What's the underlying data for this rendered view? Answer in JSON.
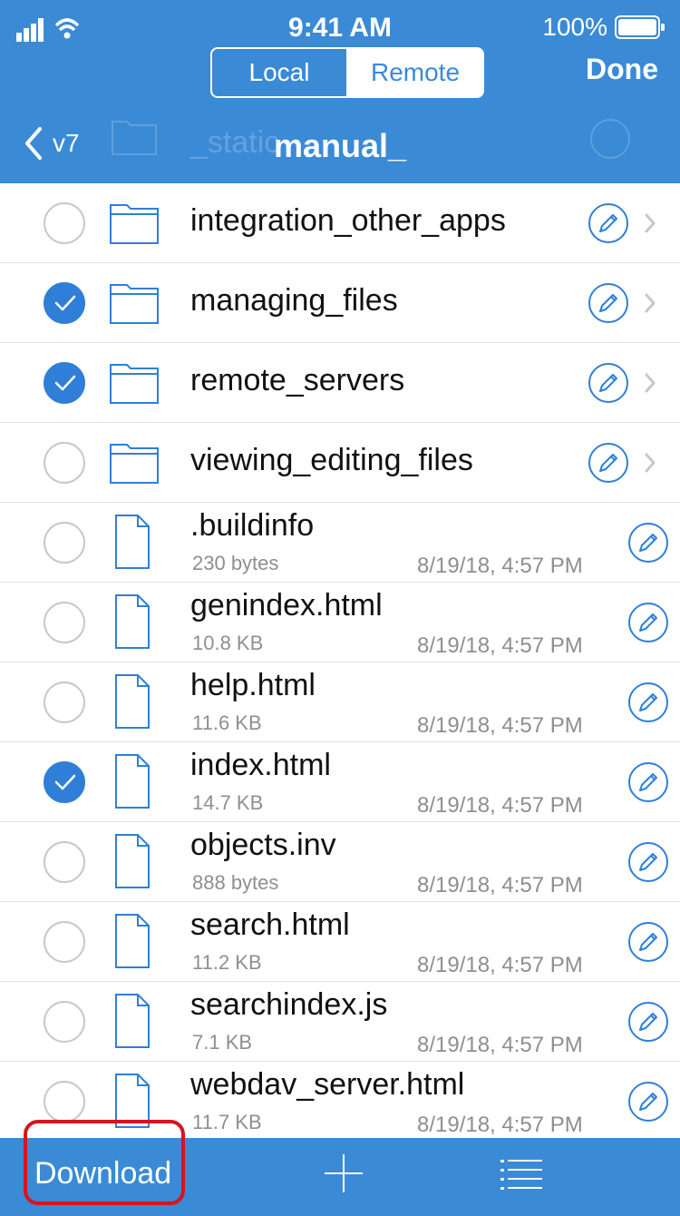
{
  "status_bar": {
    "time": "9:41 AM",
    "battery": "100%"
  },
  "nav": {
    "segments": {
      "local": "Local",
      "remote": "Remote",
      "selected": "Remote"
    },
    "done_label": "Done",
    "back_label": "v7",
    "title": "manual_",
    "ghost_label": "_static"
  },
  "items": [
    {
      "name": "integration_other_apps",
      "type": "folder",
      "checked": false
    },
    {
      "name": "managing_files",
      "type": "folder",
      "checked": true
    },
    {
      "name": "remote_servers",
      "type": "folder",
      "checked": true
    },
    {
      "name": "viewing_editing_files",
      "type": "folder",
      "checked": false
    },
    {
      "name": ".buildinfo",
      "type": "file",
      "size": "230 bytes",
      "date": "8/19/18, 4:57 PM",
      "checked": false
    },
    {
      "name": "genindex.html",
      "type": "file",
      "size": "10.8 KB",
      "date": "8/19/18, 4:57 PM",
      "checked": false
    },
    {
      "name": "help.html",
      "type": "file",
      "size": "11.6 KB",
      "date": "8/19/18, 4:57 PM",
      "checked": false
    },
    {
      "name": "index.html",
      "type": "file",
      "size": "14.7 KB",
      "date": "8/19/18, 4:57 PM",
      "checked": true
    },
    {
      "name": "objects.inv",
      "type": "file",
      "size": "888 bytes",
      "date": "8/19/18, 4:57 PM",
      "checked": false
    },
    {
      "name": "search.html",
      "type": "file",
      "size": "11.2 KB",
      "date": "8/19/18, 4:57 PM",
      "checked": false
    },
    {
      "name": "searchindex.js",
      "type": "file",
      "size": "7.1 KB",
      "date": "8/19/18, 4:57 PM",
      "checked": false
    },
    {
      "name": "webdav_server.html",
      "type": "file",
      "size": "11.7 KB",
      "date": "8/19/18, 4:57 PM",
      "checked": false
    }
  ],
  "toolbar": {
    "download_label": "Download",
    "add_icon": "plus-icon",
    "list_icon": "list-icon"
  },
  "colors": {
    "accent": "#3a8ad6",
    "check": "#2f7fd8",
    "highlight": "#d9131e"
  }
}
